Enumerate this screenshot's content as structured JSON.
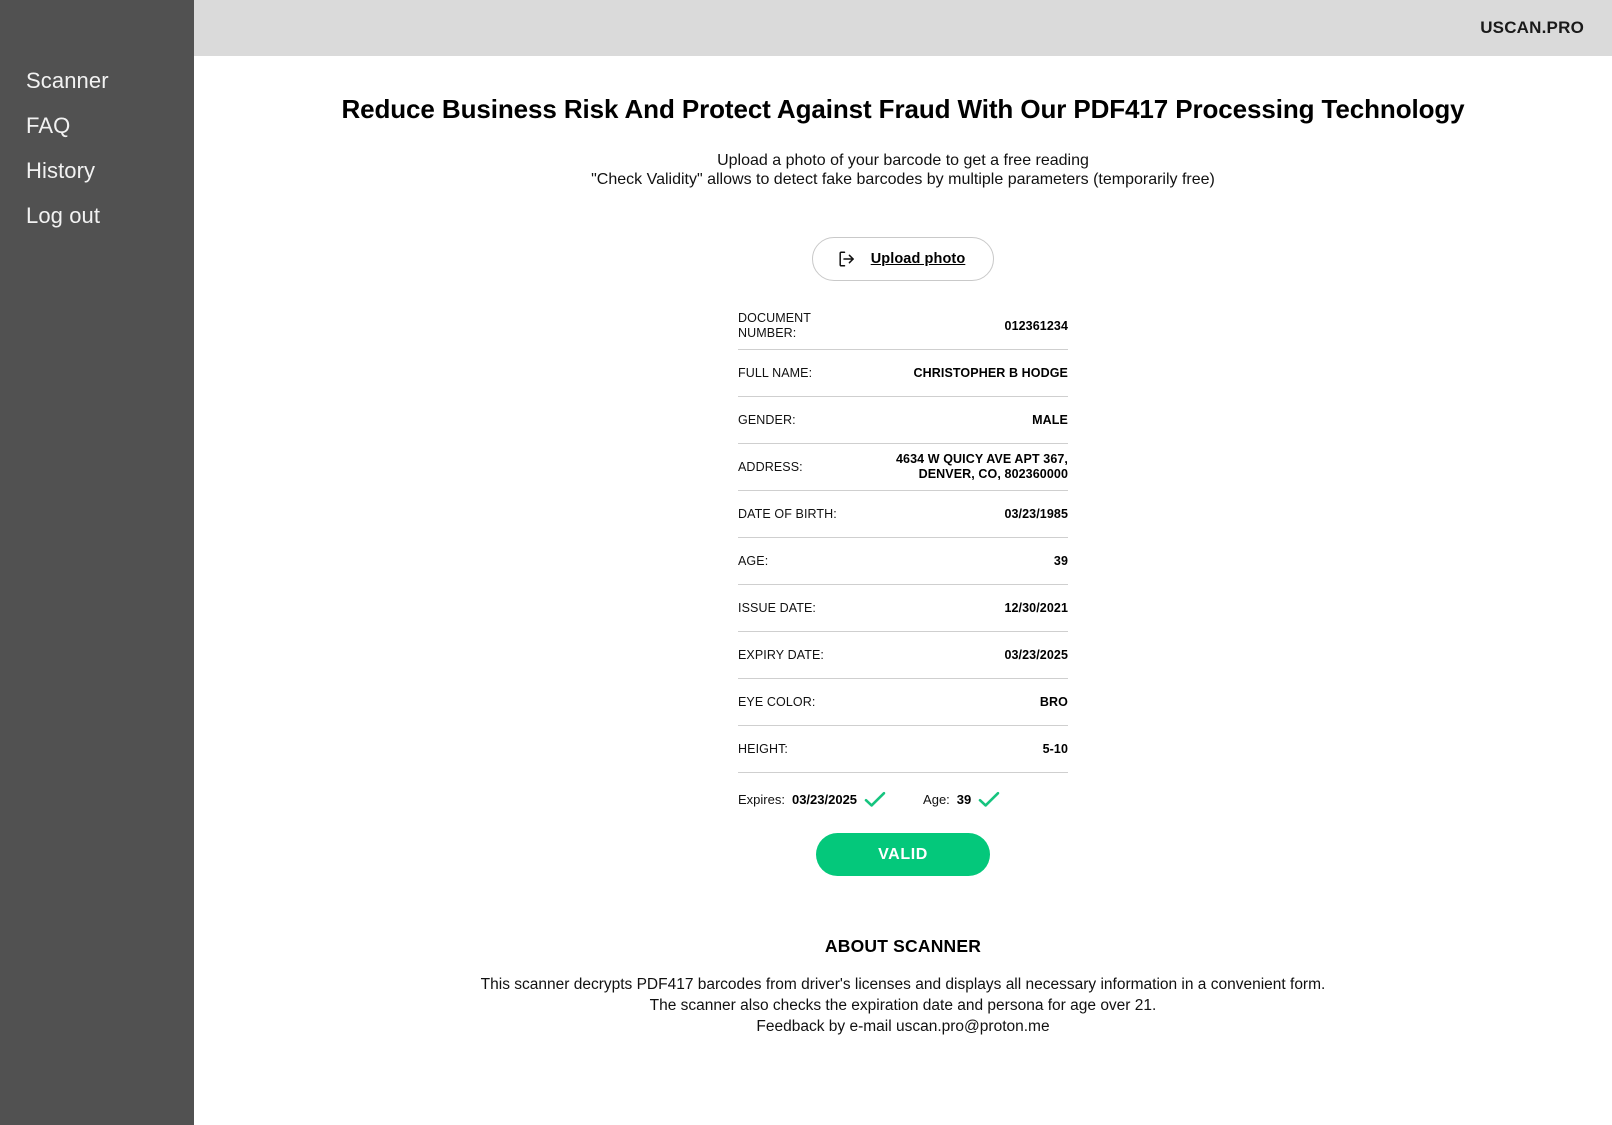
{
  "header": {
    "brand": "USCAN.PRO"
  },
  "sidebar": {
    "items": [
      {
        "label": "Scanner",
        "name": "scanner"
      },
      {
        "label": "FAQ",
        "name": "faq"
      },
      {
        "label": "History",
        "name": "history"
      },
      {
        "label": "Log out",
        "name": "log-out"
      }
    ]
  },
  "main": {
    "title": "Reduce Business Risk And Protect Against Fraud With Our PDF417 Processing Technology",
    "subtitle_line1": "Upload a photo of your barcode to get a free reading",
    "subtitle_line2": "\"Check Validity\" allows to detect fake barcodes by multiple parameters (temporarily free)",
    "upload": {
      "label": "Upload photo",
      "icon": "import-arrow-icon"
    },
    "fields": [
      {
        "label": "DOCUMENT NUMBER:",
        "value": "012361234"
      },
      {
        "label": "FULL NAME:",
        "value": "CHRISTOPHER B HODGE"
      },
      {
        "label": "GENDER:",
        "value": "MALE"
      },
      {
        "label": "ADDRESS:",
        "value": "4634 W QUICY AVE APT 367,\nDENVER, CO, 802360000"
      },
      {
        "label": "DATE OF BIRTH:",
        "value": "03/23/1985"
      },
      {
        "label": "AGE:",
        "value": "39"
      },
      {
        "label": "ISSUE DATE:",
        "value": "12/30/2021"
      },
      {
        "label": "EXPIRY DATE:",
        "value": "03/23/2025"
      },
      {
        "label": "EYE COLOR:",
        "value": "BRO"
      },
      {
        "label": "HEIGHT:",
        "value": "5-10"
      }
    ],
    "checks": [
      {
        "label": "Expires:",
        "value": "03/23/2025",
        "status": "pass",
        "icon": "check-icon"
      },
      {
        "label": "Age:",
        "value": "39",
        "status": "pass",
        "icon": "check-icon"
      }
    ],
    "status_button": {
      "label": "VALID",
      "color": "#04c87b"
    },
    "about": {
      "title": "ABOUT SCANNER",
      "line1": "This scanner decrypts PDF417 barcodes from driver's licenses and displays all necessary information in a convenient form.",
      "line2": "The scanner also checks the expiration date and persona for age over 21.",
      "line3": "Feedback by e-mail uscan.pro@proton.me"
    }
  },
  "colors": {
    "sidebar_bg": "#515151",
    "header_bg": "#dadada",
    "accent_green": "#04c87b",
    "divider": "#cfcfcf"
  }
}
